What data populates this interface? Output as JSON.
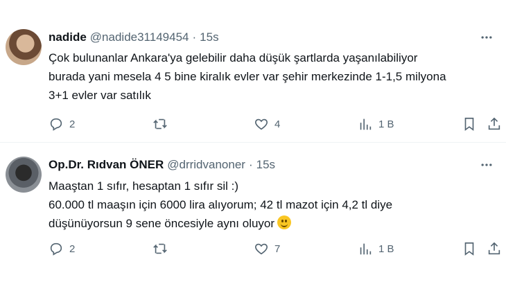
{
  "tweets": [
    {
      "name": "nadide",
      "handle": "@nadide31149454",
      "dot": "·",
      "time": "15s",
      "lines": [
        "Çok bulunanlar Ankara'ya gelebilir daha düşük şartlarda yaşanılabiliyor",
        "burada yani mesela 4 5 bine kiralık evler var şehir merkezinde 1-1,5 milyona",
        "3+1 evler var satılık"
      ],
      "replies": "2",
      "retweets": "",
      "likes": "4",
      "views": "1 B"
    },
    {
      "name": "Op.Dr. Rıdvan ÖNER",
      "handle": "@drridvanoner",
      "dot": "·",
      "time": "15s",
      "lines": [
        "Maaştan 1 sıfır, hesaptan 1 sıfır sil :)",
        "60.000 tl maaşın için 6000 lira alıyorum; 42 tl mazot için 4,2 tl diye",
        "düşünüyorsun 9 sene öncesiyle aynı oluyor"
      ],
      "emoji": "slightly-smiling-face",
      "replies": "2",
      "retweets": "",
      "likes": "7",
      "views": "1 B"
    }
  ],
  "icons": {
    "reply": "reply-icon",
    "retweet": "retweet-icon",
    "like": "like-icon",
    "views": "views-icon",
    "bookmark": "bookmark-icon",
    "share": "share-icon",
    "more": "more-icon"
  },
  "colors": {
    "text": "#0f1419",
    "secondary": "#536471",
    "divider": "#eff3f4"
  }
}
